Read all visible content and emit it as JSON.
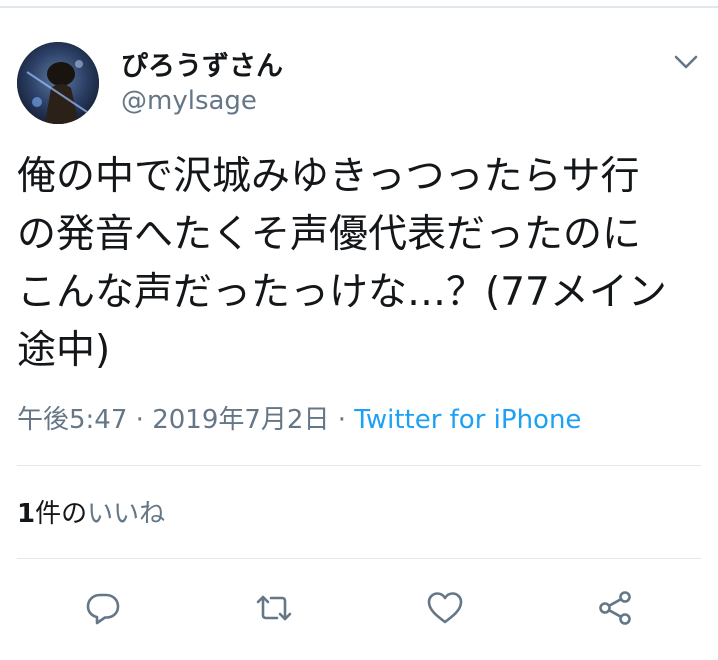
{
  "user": {
    "display_name": "ぴろうずさん",
    "handle": "@mylsage"
  },
  "tweet": {
    "text": "俺の中で沢城みゆきっつったらサ行\nの発音へたくそ声優代表だったのに\nこんな声だったっけな…？(77メイン\n途中)",
    "time": "午後5:47",
    "separator": "·",
    "date": "2019年7月2日",
    "source": "Twitter for iPhone"
  },
  "stats": {
    "like_count": "1",
    "like_unit": "件の",
    "like_label": "いいね"
  },
  "actions": [
    "reply-icon",
    "retweet-icon",
    "like-icon",
    "share-icon"
  ],
  "colors": {
    "accent": "#1da1f2",
    "secondary_text": "#657786",
    "divider": "#e1e8ed",
    "icon": "#657786"
  }
}
